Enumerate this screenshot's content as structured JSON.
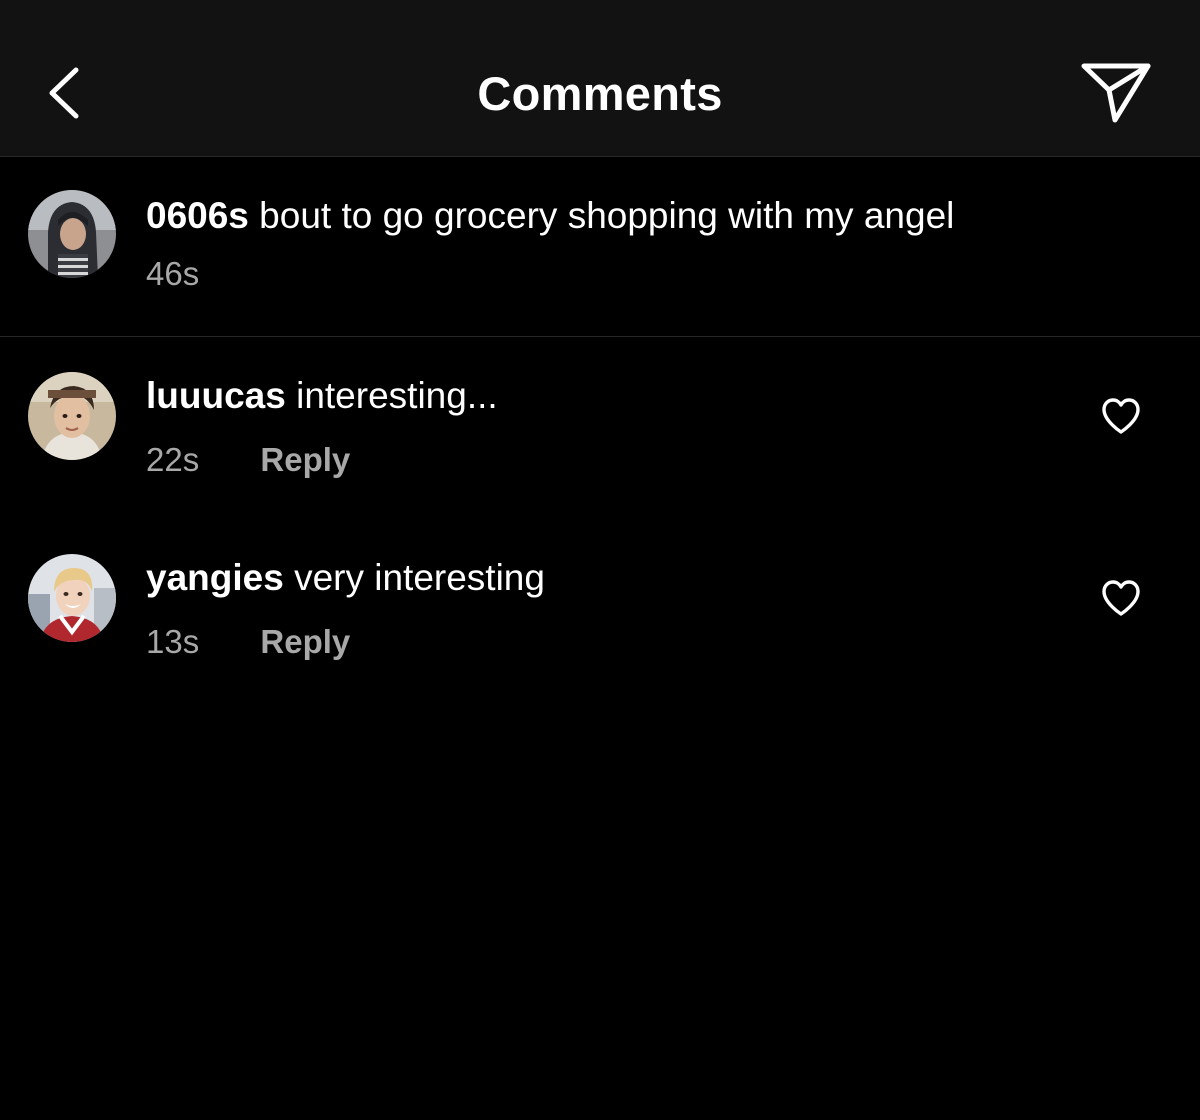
{
  "header": {
    "title": "Comments",
    "back_icon": "chevron-left-icon",
    "share_icon": "paper-plane-icon"
  },
  "caption": {
    "username": "0606s",
    "text": "bout to go grocery shopping with my angel",
    "time": "46s"
  },
  "comments": [
    {
      "username": "luuucas",
      "text": "interesting...",
      "time": "22s",
      "reply_label": "Reply"
    },
    {
      "username": "yangies",
      "text": "very interesting",
      "time": "13s",
      "reply_label": "Reply"
    }
  ],
  "colors": {
    "background": "#000000",
    "header_background": "#121212",
    "divider": "#262626",
    "text_primary": "#ffffff",
    "text_secondary": "#a8a8a8"
  }
}
